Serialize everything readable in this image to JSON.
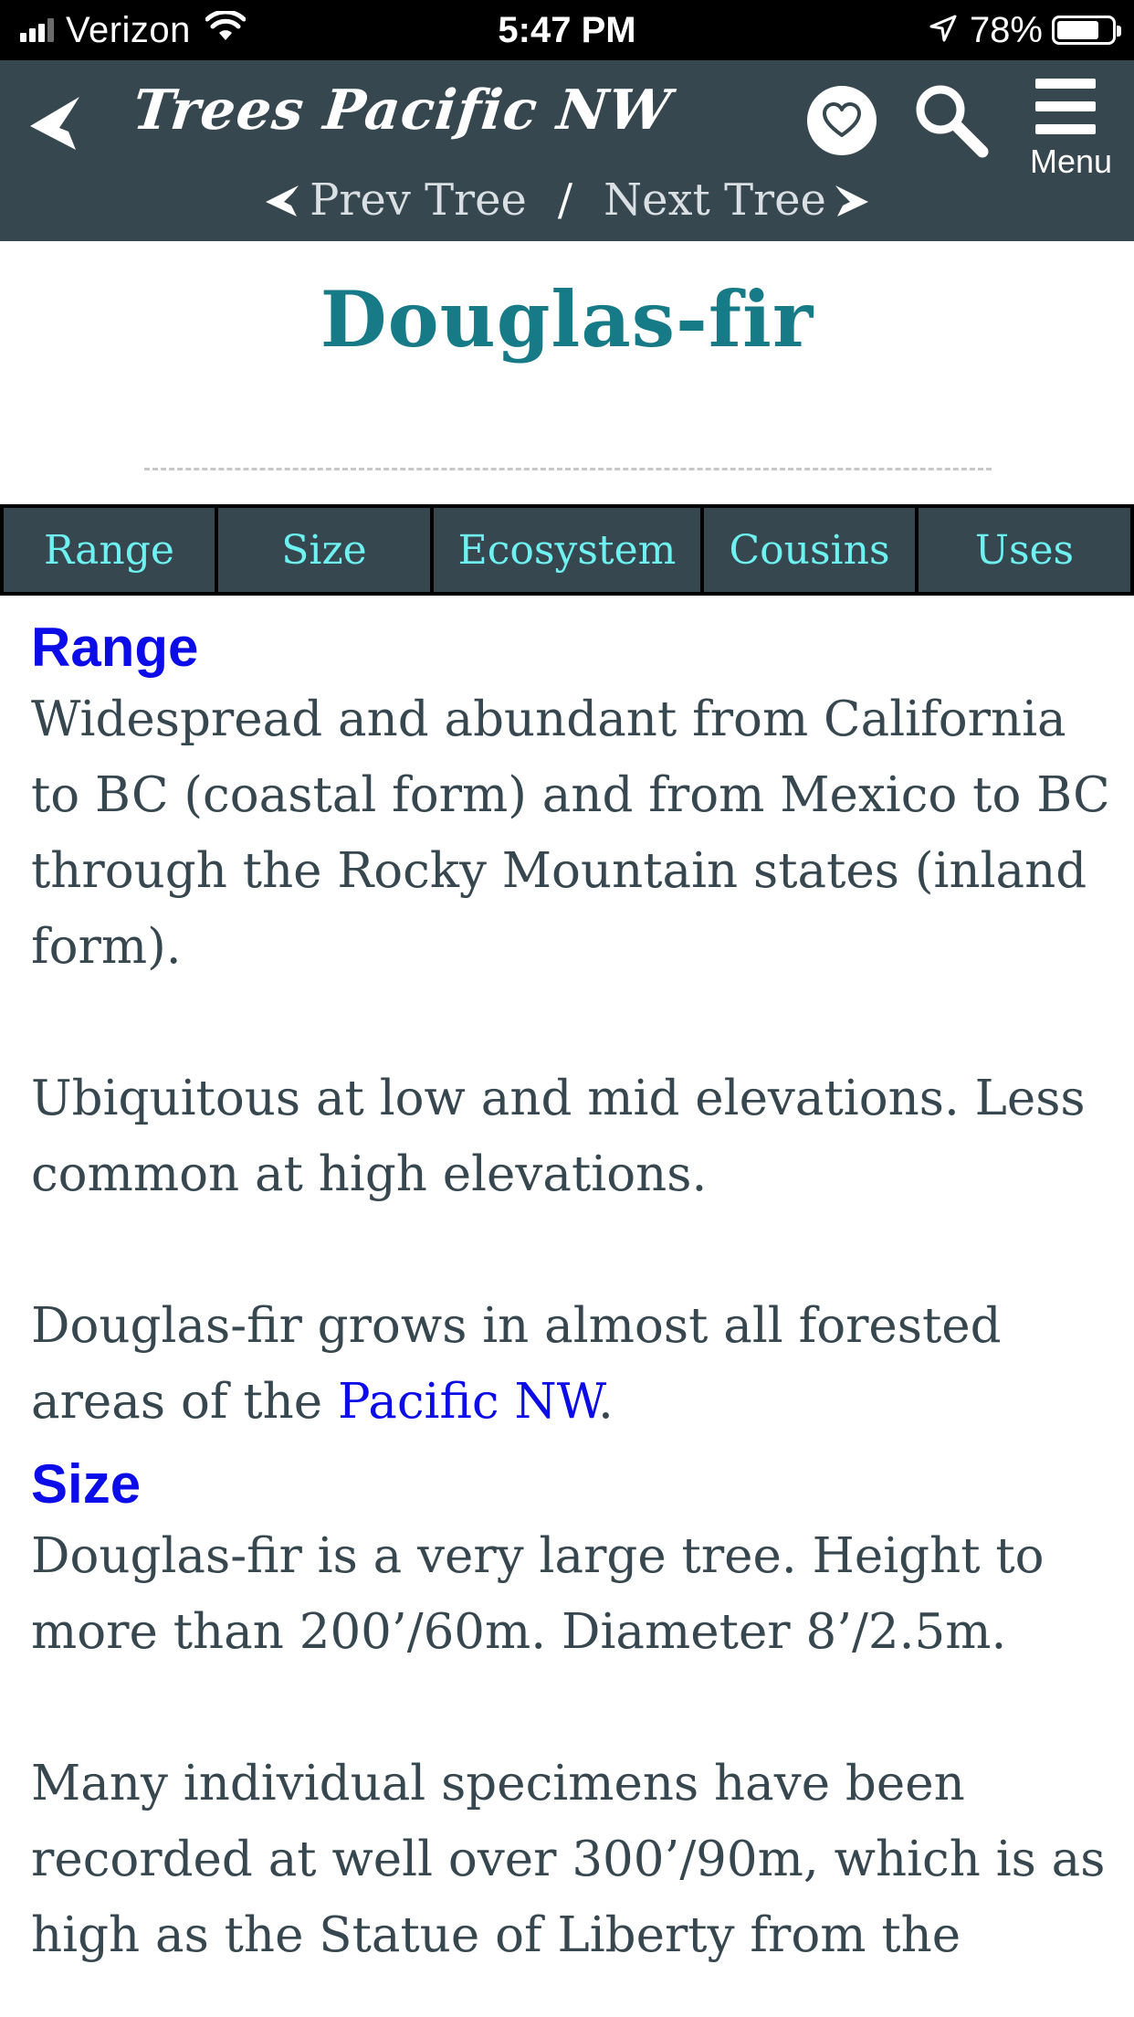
{
  "status_bar": {
    "carrier": "Verizon",
    "time": "5:47 PM",
    "battery_percent": "78%",
    "battery_level": 0.78
  },
  "header": {
    "app_title": "Trees Pacific NW",
    "menu_label": "Menu",
    "prev_tree": "Prev Tree",
    "separator": "/",
    "next_tree": "Next Tree"
  },
  "page": {
    "title": "Douglas-fir"
  },
  "tabs": [
    {
      "label": "Range"
    },
    {
      "label": "Size"
    },
    {
      "label": "Ecosystem"
    },
    {
      "label": "Cousins"
    },
    {
      "label": "Uses"
    }
  ],
  "sections": {
    "range": {
      "heading": "Range",
      "para1": "Widespread and abundant from California to BC (coastal form) and from Mexico to BC through the Rocky Mountain states (inland form).",
      "para2": "Ubiquitous at low and mid elevations. Less common at high elevations.",
      "para3_before": "Douglas-fir grows in almost all forested areas of the ",
      "para3_link": "Pacific NW",
      "para3_after": "."
    },
    "size": {
      "heading": "Size",
      "para1": "Douglas-fir is a very large tree. Height to more than 200’/60m. Diameter 8’/2.5m.",
      "para2": "Many individual specimens have been recorded at well over 300’/90m, which is as high as the Statue of Liberty from the"
    }
  },
  "colors": {
    "header_bg": "#37474f",
    "title": "#177a87",
    "tab_text": "#6ef1f1",
    "heading": "#0c0ce8",
    "body_text": "#37474f"
  },
  "icons": {
    "back": "back-arrow-icon",
    "favorite": "heart-icon",
    "search": "search-icon",
    "menu": "hamburger-menu-icon",
    "wifi": "wifi-icon",
    "location": "location-arrow-icon",
    "battery": "battery-icon"
  }
}
